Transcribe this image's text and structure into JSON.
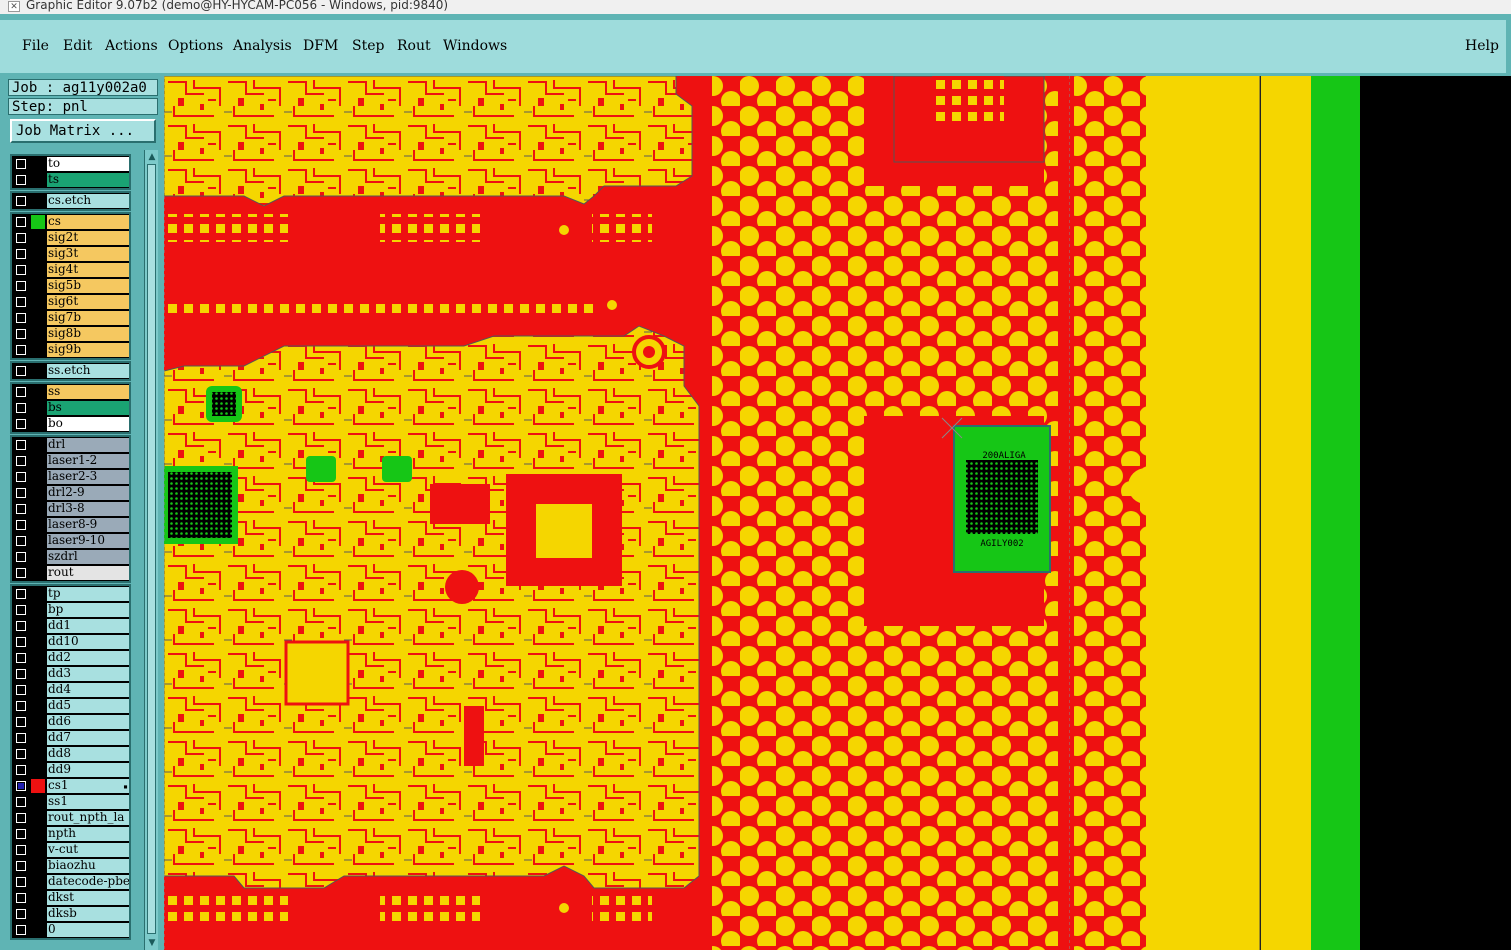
{
  "window": {
    "title": "Graphic Editor 9.07b2 (demo@HY-HYCAM-PC056 - Windows, pid:9840)"
  },
  "menu": {
    "items": [
      "File",
      "Edit",
      "Actions",
      "Options",
      "Analysis",
      "DFM",
      "Step",
      "Rout",
      "Windows"
    ],
    "help": "Help"
  },
  "panel": {
    "job": "Job : ag11y002a0",
    "step": "Step: pnl",
    "job_matrix": "Job Matrix ..."
  },
  "layers": [
    {
      "name": "to",
      "color": "#ffffff",
      "swatch": "#000000",
      "checked": false
    },
    {
      "name": "ts",
      "color": "#1aa373",
      "swatch": "#000000",
      "checked": false
    },
    {
      "name": "cs.etch",
      "color": "#a8e0e0",
      "swatch": "#000000",
      "checked": false
    },
    {
      "name": "cs",
      "color": "#f5c860",
      "swatch": "#16c616",
      "checked": false
    },
    {
      "name": "sig2t",
      "color": "#f5c860",
      "swatch": "#000000",
      "checked": false
    },
    {
      "name": "sig3t",
      "color": "#f5c860",
      "swatch": "#000000",
      "checked": false
    },
    {
      "name": "sig4t",
      "color": "#f5c860",
      "swatch": "#000000",
      "checked": false
    },
    {
      "name": "sig5b",
      "color": "#f5c860",
      "swatch": "#000000",
      "checked": false
    },
    {
      "name": "sig6t",
      "color": "#f5c860",
      "swatch": "#000000",
      "checked": false
    },
    {
      "name": "sig7b",
      "color": "#f5c860",
      "swatch": "#000000",
      "checked": false
    },
    {
      "name": "sig8b",
      "color": "#f5c860",
      "swatch": "#000000",
      "checked": false
    },
    {
      "name": "sig9b",
      "color": "#f5c860",
      "swatch": "#000000",
      "checked": false
    },
    {
      "name": "ss.etch",
      "color": "#a8e0e0",
      "swatch": "#000000",
      "checked": false
    },
    {
      "name": "ss",
      "color": "#f5c860",
      "swatch": "#000000",
      "checked": false
    },
    {
      "name": "bs",
      "color": "#1aa373",
      "swatch": "#000000",
      "checked": false
    },
    {
      "name": "bo",
      "color": "#ffffff",
      "swatch": "#000000",
      "checked": false
    },
    {
      "name": "drl",
      "color": "#9aaab8",
      "swatch": "#000000",
      "checked": false
    },
    {
      "name": "laser1-2",
      "color": "#9aaab8",
      "swatch": "#000000",
      "checked": false
    },
    {
      "name": "laser2-3",
      "color": "#9aaab8",
      "swatch": "#000000",
      "checked": false
    },
    {
      "name": "drl2-9",
      "color": "#9aaab8",
      "swatch": "#000000",
      "checked": false
    },
    {
      "name": "drl3-8",
      "color": "#9aaab8",
      "swatch": "#000000",
      "checked": false
    },
    {
      "name": "laser8-9",
      "color": "#9aaab8",
      "swatch": "#000000",
      "checked": false
    },
    {
      "name": "laser9-10",
      "color": "#9aaab8",
      "swatch": "#000000",
      "checked": false
    },
    {
      "name": "szdrl",
      "color": "#9aaab8",
      "swatch": "#000000",
      "checked": false
    },
    {
      "name": "rout",
      "color": "#e4e4e4",
      "swatch": "#000000",
      "checked": false
    },
    {
      "name": "tp",
      "color": "#a8e0e0",
      "swatch": "#000000",
      "checked": false
    },
    {
      "name": "bp",
      "color": "#a8e0e0",
      "swatch": "#000000",
      "checked": false
    },
    {
      "name": "dd1",
      "color": "#a8e0e0",
      "swatch": "#000000",
      "checked": false
    },
    {
      "name": "dd10",
      "color": "#a8e0e0",
      "swatch": "#000000",
      "checked": false
    },
    {
      "name": "dd2",
      "color": "#a8e0e0",
      "swatch": "#000000",
      "checked": false
    },
    {
      "name": "dd3",
      "color": "#a8e0e0",
      "swatch": "#000000",
      "checked": false
    },
    {
      "name": "dd4",
      "color": "#a8e0e0",
      "swatch": "#000000",
      "checked": false
    },
    {
      "name": "dd5",
      "color": "#a8e0e0",
      "swatch": "#000000",
      "checked": false
    },
    {
      "name": "dd6",
      "color": "#a8e0e0",
      "swatch": "#000000",
      "checked": false
    },
    {
      "name": "dd7",
      "color": "#a8e0e0",
      "swatch": "#000000",
      "checked": false
    },
    {
      "name": "dd8",
      "color": "#a8e0e0",
      "swatch": "#000000",
      "checked": false
    },
    {
      "name": "dd9",
      "color": "#a8e0e0",
      "swatch": "#000000",
      "checked": false
    },
    {
      "name": "cs1",
      "color": "#a8e0e0",
      "swatch": "#ee1111",
      "checked": true,
      "marker": "▪"
    },
    {
      "name": "ss1",
      "color": "#a8e0e0",
      "swatch": "#000000",
      "checked": false
    },
    {
      "name": "rout_npth_la",
      "color": "#a8e0e0",
      "swatch": "#000000",
      "checked": false
    },
    {
      "name": "npth",
      "color": "#a8e0e0",
      "swatch": "#000000",
      "checked": false
    },
    {
      "name": "v-cut",
      "color": "#a8e0e0",
      "swatch": "#000000",
      "checked": false
    },
    {
      "name": "biaozhu",
      "color": "#a8e0e0",
      "swatch": "#000000",
      "checked": false
    },
    {
      "name": "datecode-pbe",
      "color": "#a8e0e0",
      "swatch": "#000000",
      "checked": false
    },
    {
      "name": "dkst",
      "color": "#a8e0e0",
      "swatch": "#000000",
      "checked": false
    },
    {
      "name": "dksb",
      "color": "#a8e0e0",
      "swatch": "#000000",
      "checked": false
    },
    {
      "name": "0",
      "color": "#a8e0e0",
      "swatch": "#000000",
      "checked": false
    }
  ],
  "canvas": {
    "chip_label_top": "200ALIGA",
    "chip_label_bottom": "AGILY002",
    "colors": {
      "copper": "#f5d600",
      "board": "#ee1111",
      "mask": "#16c616",
      "background": "#000000"
    }
  }
}
